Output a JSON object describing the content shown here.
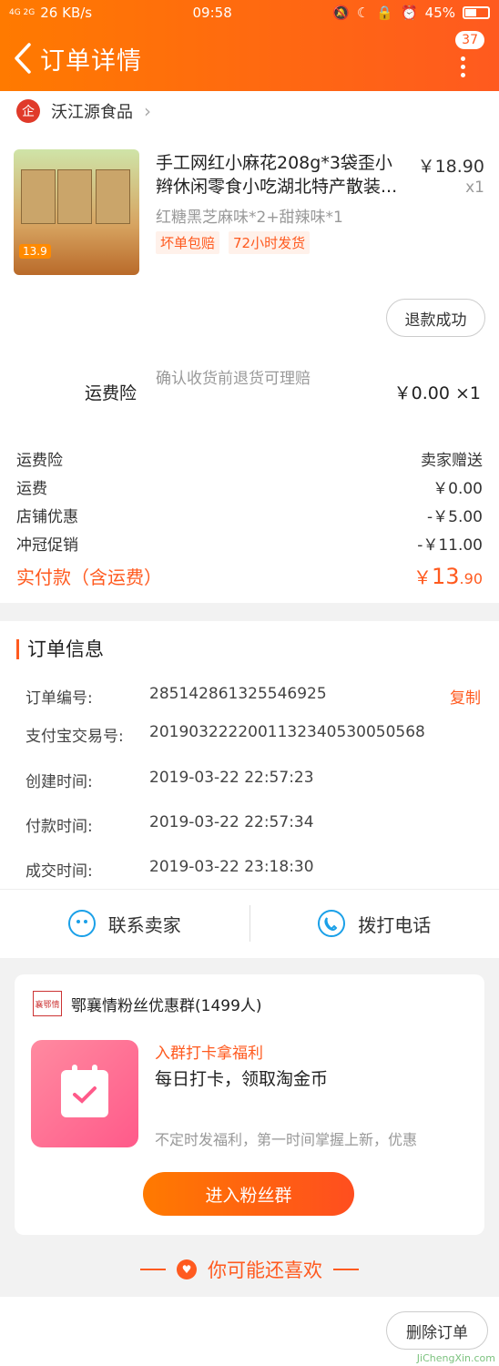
{
  "status_bar": {
    "network": "4G 2G",
    "speed": "26 KB/s",
    "time": "09:58",
    "battery": "45%"
  },
  "header": {
    "title": "订单详情",
    "badge": "37"
  },
  "shop": {
    "name": "沃江源食品",
    "logo": "企"
  },
  "product": {
    "title": "手工网红小麻花208g*3袋歪小辫休闲零食小吃湖北特产散装...",
    "price": "￥18.90",
    "qty": "x1",
    "sku": "红糖黑芝麻味*2+甜辣味*1",
    "tags": [
      "坏单包赔",
      "72小时发货"
    ],
    "thumb_price": "13.9",
    "refund_button": "退款成功"
  },
  "insurance": {
    "label": "运费险",
    "desc": "确认收货前退货可理赔",
    "price": "￥0.00 ×1"
  },
  "fees": [
    {
      "label": "运费险",
      "value": "卖家赠送"
    },
    {
      "label": "运费",
      "value": "￥0.00"
    },
    {
      "label": "店铺优惠",
      "value": "-￥5.00"
    },
    {
      "label": "冲冠促销",
      "value": "-￥11.00"
    }
  ],
  "total": {
    "label": "实付款（含运费）",
    "currency": "￥",
    "int": "13",
    "dec": ".90"
  },
  "order_info": {
    "title": "订单信息",
    "copy_label": "复制",
    "rows": [
      {
        "label": "订单编号:",
        "value": "285142861325546925"
      },
      {
        "label": "支付宝交易号:",
        "value": "2019032222001132340530050568"
      },
      {
        "label": "创建时间:",
        "value": "2019-03-22 22:57:23"
      },
      {
        "label": "付款时间:",
        "value": "2019-03-22 22:57:34"
      },
      {
        "label": "成交时间:",
        "value": "2019-03-22 23:18:30"
      }
    ],
    "contact_seller": "联系卖家",
    "call_phone": "拨打电话"
  },
  "group": {
    "name": "鄂襄情粉丝优惠群(1499人)",
    "logo_text": "襄鄂情",
    "promo_title": "入群打卡拿福利",
    "promo_sub": "每日打卡，领取淘金币",
    "promo_desc": "不定时发福利，第一时间掌握上新，优惠",
    "join_button": "进入粉丝群"
  },
  "guess": {
    "label": "你可能还喜欢"
  },
  "bottom": {
    "delete_button": "删除订单",
    "watermark": "JiChengXin.com"
  },
  "colors": {
    "accent": "#ff5a1f",
    "header_start": "#ff7a00"
  }
}
